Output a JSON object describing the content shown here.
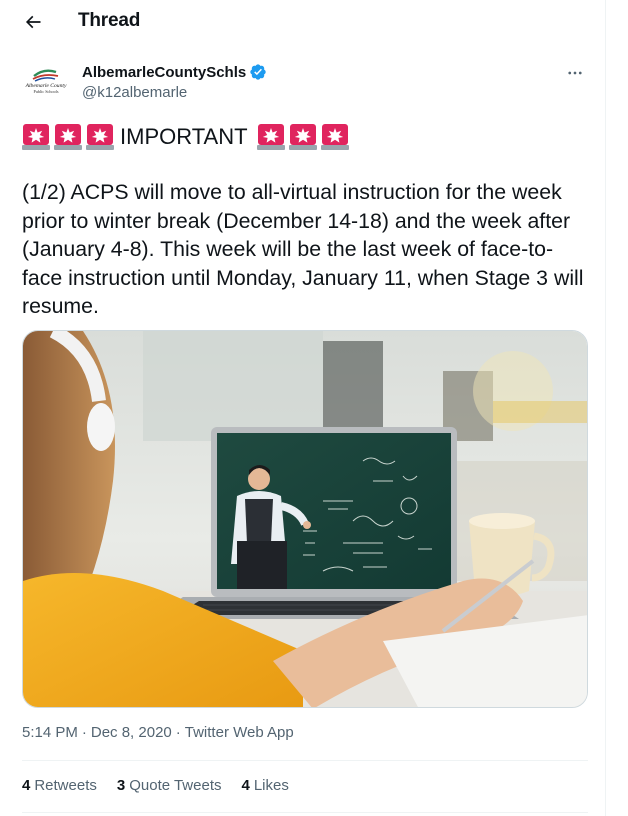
{
  "header": {
    "title": "Thread",
    "back_icon": "arrow-left-icon"
  },
  "author": {
    "display_name": "AlbemarleCountySchls",
    "handle": "@k12albemarle",
    "verified_icon": "verified-badge-icon",
    "avatar_lines": [
      "Albemarle County",
      "Public Schools"
    ]
  },
  "tweet": {
    "important_word": "IMPORTANT",
    "emoji": "rotating-light-icon",
    "text": "(1/2) ACPS will move to all-virtual instruction for the week prior to winter break (December 14-18) and the week after (January 4-8). This week will be the last week of face-to-face instruction until Monday, January 11, when Stage 3 will resume."
  },
  "meta": {
    "time": "5:14 PM",
    "date": "Dec 8, 2020",
    "source": "Twitter Web App",
    "sep": "·"
  },
  "stats": {
    "retweets_count": "4",
    "retweets_label": "Retweets",
    "quotes_count": "3",
    "quotes_label": "Quote Tweets",
    "likes_count": "4",
    "likes_label": "Likes"
  },
  "colors": {
    "text": "#0f1419",
    "secondary": "#536471",
    "verified": "#1d9bf0",
    "border": "#eff3f4"
  }
}
